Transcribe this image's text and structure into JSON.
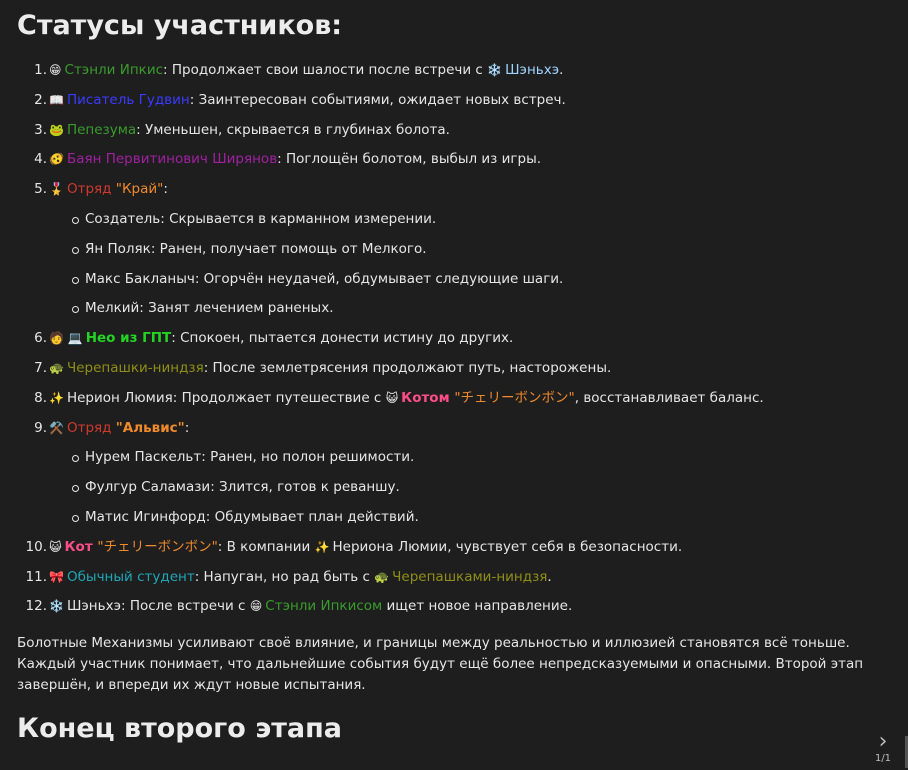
{
  "heading": "Статусы участников:",
  "items": [
    {
      "num": "1.",
      "emoji": "😁",
      "name": "Стэнли Ипкис",
      "text": ": Продолжает свои шалости после встречи с ",
      "emoji2": "❄️",
      "name2": "Шэньхэ",
      "end": "."
    },
    {
      "num": "2.",
      "emoji": "📖",
      "name": "Писатель Гудвин",
      "text": ": Заинтересован событиями, ожидает новых встреч."
    },
    {
      "num": "3.",
      "emoji": "🐸",
      "name": "Пепезума",
      "text": ": Уменьшен, скрывается в глубинах болота."
    },
    {
      "num": "4.",
      "emoji": "🫨",
      "name": "Баян Первитинович Ширянов",
      "text": ": Поглощён болотом, выбыл из игры."
    },
    {
      "num": "5.",
      "emoji": "🎖️",
      "name": "Отряд ",
      "name_quoted": "\"Край\"",
      "text": ":",
      "sub": [
        "Создатель: Скрывается в карманном измерении.",
        "Ян Поляк: Ранен, получает помощь от Мелкого.",
        "Макс Бакланыч: Огорчён неудачей, обдумывает следующие шаги.",
        "Мелкий: Занят лечением раненых."
      ]
    },
    {
      "num": "6.",
      "emoji": "🧑 💻",
      "name": "Нео из ГПТ",
      "text": ": Спокоен, пытается донести истину до других."
    },
    {
      "num": "7.",
      "emoji": "🐢",
      "name": "Черепашки-ниндзя",
      "text": ": После землетрясения продолжают путь, насторожены."
    },
    {
      "num": "8.",
      "emoji": "✨",
      "text": "Нерион Люмия: Продолжает путешествие с ",
      "emoji2": "😺",
      "name2": "Котом ",
      "name2_quoted": "\"チェリーボンボン\"",
      "end": ", восстанавливает баланс."
    },
    {
      "num": "9.",
      "emoji": "⚒️",
      "name": "Отряд ",
      "name_quoted": "\"Альвис\"",
      "text": ":",
      "sub": [
        "Нурем Паскельт: Ранен, но полон решимости.",
        "Фулгур Саламази: Злится, готов к реваншу.",
        "Матис Игинфорд: Обдумывает план действий."
      ]
    },
    {
      "num": "10.",
      "emoji": "😺",
      "name": "Кот ",
      "name_quoted": "\"チェリーボンボン\"",
      "text": ": В компании ",
      "emoji2": "✨",
      "end": "Нериона Люмии, чувствует себя в безопасности."
    },
    {
      "num": "11.",
      "emoji": "🎀",
      "name": "Обычный студент",
      "text": ": Напуган, но рад быть с ",
      "emoji2": "🐢",
      "name2": "Черепашками-ниндзя",
      "end": "."
    },
    {
      "num": "12.",
      "emoji": "❄️",
      "text": "Шэньхэ: После встречи с ",
      "emoji2": "😁",
      "name2": "Стэнли Ипкисом",
      "end": " ищет новое направление."
    }
  ],
  "paragraph": "Болотные Механизмы усиливают своё влияние, и границы между реальностью и иллюзией становятся всё тоньше. Каждый участник понимает, что дальнейшие события будут ещё более непредсказуемыми и опасными. Второй этап завершён, и впереди их ждут новые испытания.",
  "heading2": "Конец второго этапа",
  "pager": {
    "arrow": "›",
    "count": "1/1"
  },
  "colors": {
    "background": "#1e1e1f",
    "text": "#e6e6e6",
    "green": "#3a9b2c",
    "blue": "#3a3aff",
    "purple": "#a020a0",
    "red": "#d0392b",
    "orange": "#f08a2b",
    "lime": "#23d423",
    "olive": "#8f8f16",
    "pink": "#ff4d8a",
    "cyan": "#1fa7b5",
    "lightblue": "#9ed4ff"
  }
}
